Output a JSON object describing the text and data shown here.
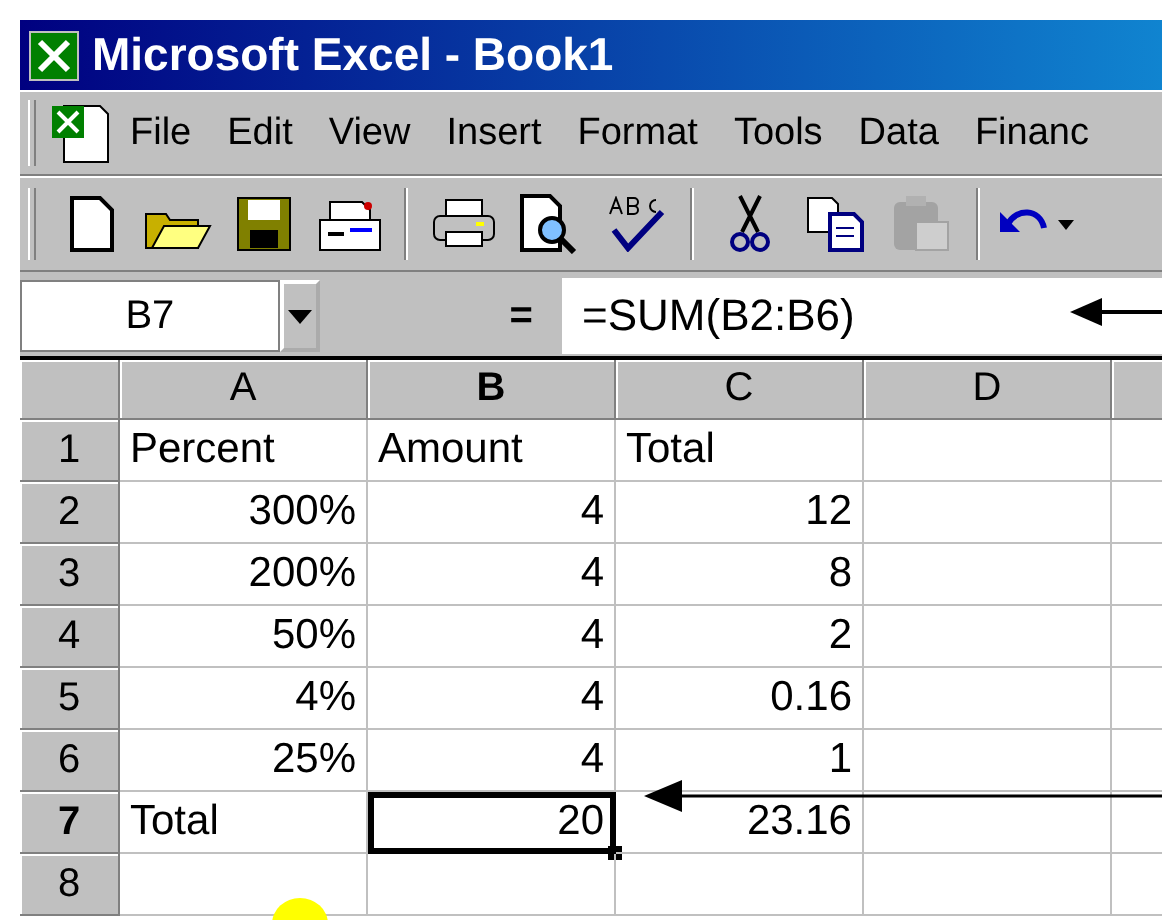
{
  "window": {
    "title": "Microsoft Excel - Book1"
  },
  "menu": [
    "File",
    "Edit",
    "View",
    "Insert",
    "Format",
    "Tools",
    "Data",
    "Financ"
  ],
  "toolbar": [
    {
      "kind": "new",
      "disabled": false
    },
    {
      "kind": "open",
      "disabled": false
    },
    {
      "kind": "save",
      "disabled": false
    },
    {
      "kind": "mail",
      "disabled": false
    },
    {
      "kind": "sep"
    },
    {
      "kind": "print",
      "disabled": false
    },
    {
      "kind": "preview",
      "disabled": false
    },
    {
      "kind": "spell",
      "disabled": false
    },
    {
      "kind": "sep"
    },
    {
      "kind": "cut",
      "disabled": false
    },
    {
      "kind": "copy",
      "disabled": false
    },
    {
      "kind": "paste",
      "disabled": true
    },
    {
      "kind": "sep"
    },
    {
      "kind": "undo",
      "disabled": false
    }
  ],
  "formula_bar": {
    "name_box": "B7",
    "equals": "=",
    "formula": "=SUM(B2:B6)"
  },
  "columns": [
    {
      "label": "A",
      "selected": false
    },
    {
      "label": "B",
      "selected": true
    },
    {
      "label": "C",
      "selected": false
    },
    {
      "label": "D",
      "selected": false
    }
  ],
  "rows": [
    {
      "header": "1",
      "selected": false,
      "cells": [
        {
          "text": "Percent",
          "kind": "text",
          "selected": false
        },
        {
          "text": "Amount",
          "kind": "text",
          "selected": false
        },
        {
          "text": "Total",
          "kind": "text",
          "selected": false
        }
      ]
    },
    {
      "header": "2",
      "selected": false,
      "cells": [
        {
          "text": "300%",
          "kind": "number",
          "selected": false
        },
        {
          "text": "4",
          "kind": "number",
          "selected": false
        },
        {
          "text": "12",
          "kind": "number",
          "selected": false
        }
      ]
    },
    {
      "header": "3",
      "selected": false,
      "cells": [
        {
          "text": "200%",
          "kind": "number",
          "selected": false
        },
        {
          "text": "4",
          "kind": "number",
          "selected": false
        },
        {
          "text": "8",
          "kind": "number",
          "selected": false
        }
      ]
    },
    {
      "header": "4",
      "selected": false,
      "cells": [
        {
          "text": "50%",
          "kind": "number",
          "selected": false
        },
        {
          "text": "4",
          "kind": "number",
          "selected": false
        },
        {
          "text": "2",
          "kind": "number",
          "selected": false
        }
      ]
    },
    {
      "header": "5",
      "selected": false,
      "cells": [
        {
          "text": "4%",
          "kind": "number",
          "selected": false
        },
        {
          "text": "4",
          "kind": "number",
          "selected": false
        },
        {
          "text": "0.16",
          "kind": "number",
          "selected": false
        }
      ]
    },
    {
      "header": "6",
      "selected": false,
      "cells": [
        {
          "text": "25%",
          "kind": "number",
          "selected": false
        },
        {
          "text": "4",
          "kind": "number",
          "selected": false
        },
        {
          "text": "1",
          "kind": "number",
          "selected": false
        }
      ]
    },
    {
      "header": "7",
      "selected": true,
      "cells": [
        {
          "text": "Total",
          "kind": "text",
          "selected": false
        },
        {
          "text": "20",
          "kind": "number",
          "selected": true
        },
        {
          "text": "23.16",
          "kind": "number",
          "selected": false
        }
      ]
    },
    {
      "header": "8",
      "selected": false,
      "cells": []
    }
  ]
}
